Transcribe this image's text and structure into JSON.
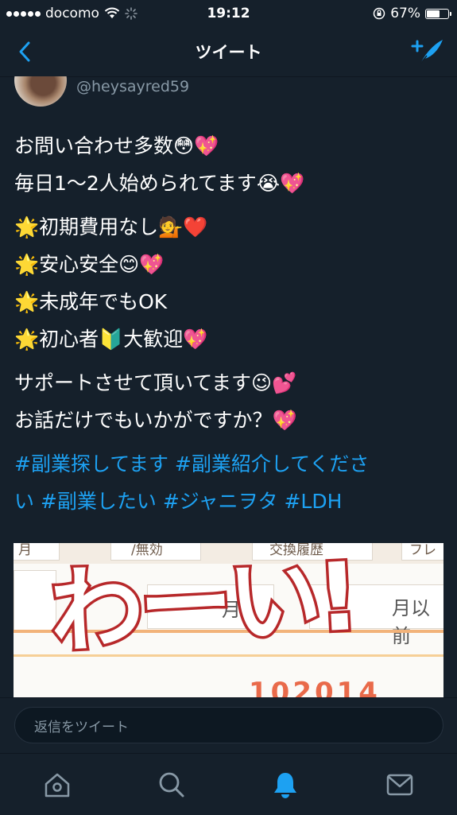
{
  "status_bar": {
    "carrier": "docomo",
    "time": "19:12",
    "battery_percent": "67%",
    "battery_level": 0.67
  },
  "nav": {
    "title": "ツイート",
    "back_icon": "chevron-left-icon",
    "compose_icon": "compose-tweet-icon"
  },
  "tweet": {
    "handle": "@heysayred59",
    "paragraphs": [
      [
        "お問い合わせ多数😳💖",
        "毎日1〜2人始められてます😭💖"
      ],
      [
        "🌟初期費用なし💁❤️",
        "🌟安心安全😊💖",
        "🌟未成年でもOK",
        "🌟初心者🔰大歓迎💖"
      ],
      [
        "サポートさせて頂いてます😉💕",
        "お話だけでもいかがですか？💖"
      ]
    ],
    "hashtags": [
      "#副業探してます #副業紹介してくださ",
      "い #副業したい #ジャニヲタ #LDH"
    ],
    "image": {
      "overlay_text": "わーい!",
      "header_cells": [
        "月",
        "/無効",
        "交換履歴",
        "フレ"
      ],
      "row_text": [
        "月",
        "月以前"
      ],
      "bottom_text": "102014"
    }
  },
  "reply": {
    "placeholder": "返信をツイート"
  },
  "tabs": [
    {
      "icon": "home-icon",
      "active": false
    },
    {
      "icon": "search-icon",
      "active": false
    },
    {
      "icon": "notifications-icon",
      "active": true
    },
    {
      "icon": "messages-icon",
      "active": false
    }
  ],
  "colors": {
    "background": "#15202b",
    "accent": "#1da1f2",
    "secondary_text": "#8899a6",
    "overlay_red": "#b7282a"
  }
}
